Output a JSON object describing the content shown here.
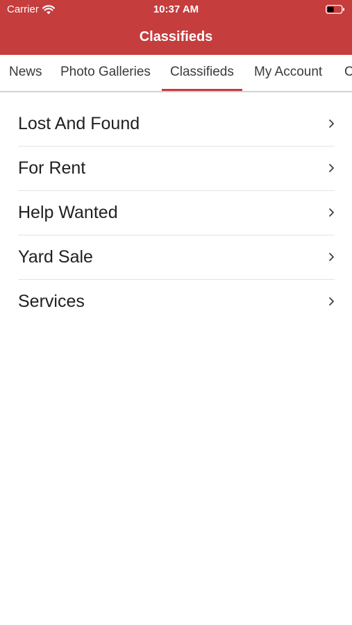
{
  "status_bar": {
    "carrier": "Carrier",
    "time": "10:37 AM",
    "wifi_icon": "wifi-icon",
    "battery_icon": "battery-icon"
  },
  "header": {
    "title": "Classifieds",
    "background_color": "#c53d3d"
  },
  "tabs": [
    {
      "label": "News",
      "active": false
    },
    {
      "label": "Photo Galleries",
      "active": false
    },
    {
      "label": "Classifieds",
      "active": true
    },
    {
      "label": "My Account",
      "active": false
    },
    {
      "label": "C",
      "active": false
    }
  ],
  "list": {
    "items": [
      {
        "label": "Lost And Found",
        "icon": "chevron-right-icon"
      },
      {
        "label": "For Rent",
        "icon": "chevron-right-icon"
      },
      {
        "label": "Help Wanted",
        "icon": "chevron-right-icon"
      },
      {
        "label": "Yard Sale",
        "icon": "chevron-right-icon"
      },
      {
        "label": "Services",
        "icon": "chevron-right-icon"
      }
    ]
  },
  "accent_color": "#c53d3d"
}
